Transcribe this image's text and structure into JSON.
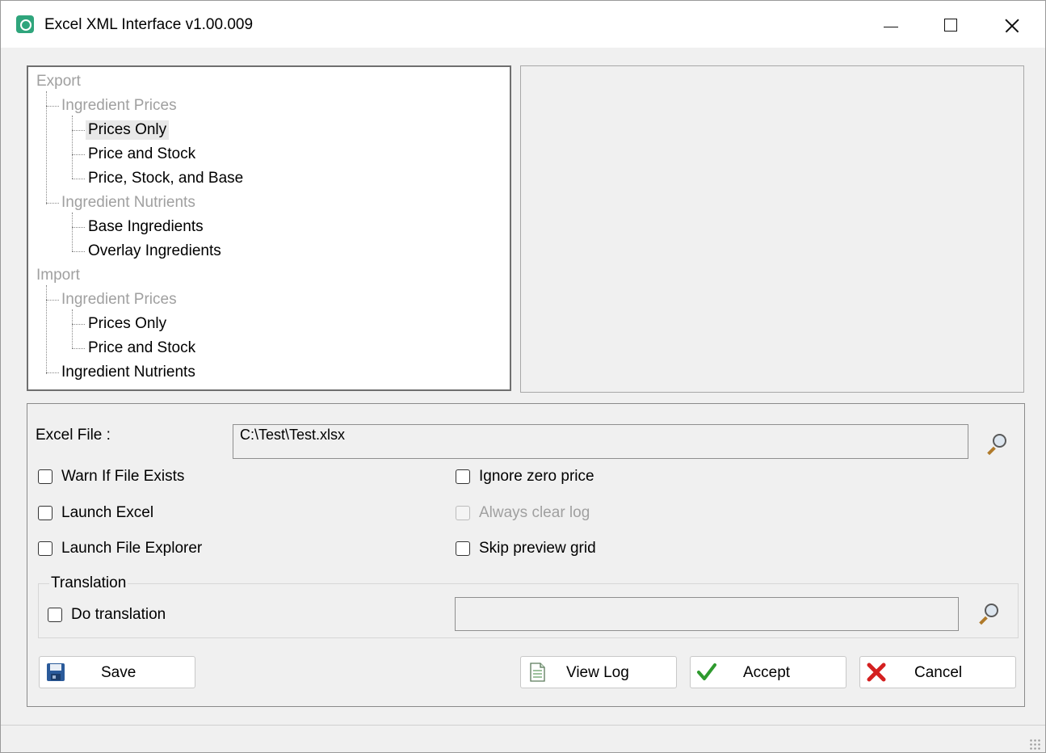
{
  "window": {
    "title": "Excel XML Interface v1.00.009",
    "controls": {
      "minimize": "minimize",
      "maximize": "maximize",
      "close": "close"
    }
  },
  "tree": {
    "export": {
      "label": "Export",
      "ingredient_prices": {
        "label": "Ingredient Prices",
        "prices_only": "Prices Only",
        "price_and_stock": "Price and Stock",
        "price_stock_base": "Price, Stock, and Base"
      },
      "ingredient_nutrients": {
        "label": "Ingredient Nutrients",
        "base_ingredients": "Base Ingredients",
        "overlay_ingredients": "Overlay Ingredients"
      }
    },
    "import": {
      "label": "Import",
      "ingredient_prices": {
        "label": "Ingredient Prices",
        "prices_only": "Prices Only",
        "price_and_stock": "Price and Stock"
      },
      "ingredient_nutrients": {
        "label": "Ingredient Nutrients"
      }
    },
    "selected": "Export > Ingredient Prices > Prices Only"
  },
  "form": {
    "excel_file_label": "Excel File :",
    "excel_file_value": "C:\\Test\\Test.xlsx",
    "options": {
      "warn_if_exists": {
        "label": "Warn If File Exists",
        "checked": false,
        "enabled": true
      },
      "launch_excel": {
        "label": "Launch Excel",
        "checked": false,
        "enabled": true
      },
      "launch_explorer": {
        "label": "Launch File Explorer",
        "checked": false,
        "enabled": true
      },
      "ignore_zero_price": {
        "label": "Ignore zero price",
        "checked": false,
        "enabled": true
      },
      "always_clear_log": {
        "label": "Always clear log",
        "checked": false,
        "enabled": false
      },
      "skip_preview_grid": {
        "label": "Skip preview grid",
        "checked": false,
        "enabled": true
      }
    },
    "translation": {
      "legend": "Translation",
      "do_translation": {
        "label": "Do translation",
        "checked": false
      },
      "file_value": ""
    }
  },
  "buttons": {
    "save": "Save",
    "view_log": "View Log",
    "accept": "Accept",
    "cancel": "Cancel"
  },
  "icons": {
    "save": "floppy-disk-icon",
    "view_log": "document-icon",
    "accept": "green-checkmark-icon",
    "cancel": "red-x-icon",
    "browse": "magnifier-icon"
  },
  "colors": {
    "disabled_text": "#a0a0a0",
    "accept_check": "#2e9a2e",
    "cancel_x": "#d42020",
    "app_icon": "#2fa57c"
  }
}
